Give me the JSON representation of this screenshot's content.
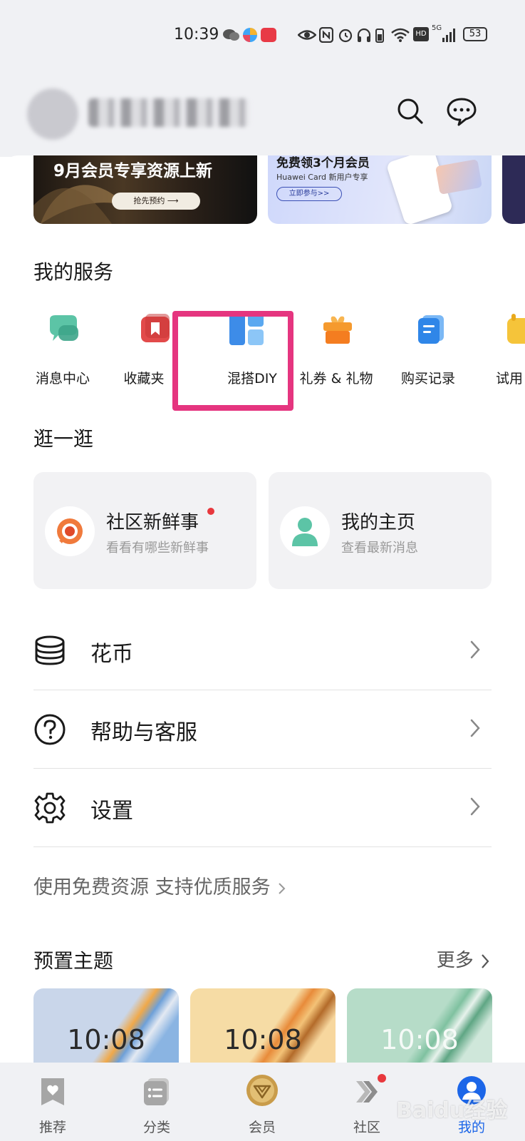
{
  "status_bar": {
    "time": "10:39",
    "network": "5G",
    "hd": "HD",
    "battery": "53"
  },
  "banners": [
    {
      "title": "9月会员专享资源上新",
      "button": "抢先预约 ⟶"
    },
    {
      "title": "免费领3个月会员",
      "subtitle": "Huawei Card 新用户专享",
      "button": "立即参与>>"
    }
  ],
  "services": {
    "title": "我的服务",
    "items": [
      {
        "label": "消息中心",
        "icon": "chat-bubbles-icon"
      },
      {
        "label": "收藏夹",
        "icon": "bookmark-icon"
      },
      {
        "label": "混搭DIY",
        "icon": "mix-diy-icon"
      },
      {
        "label": "礼券 & 礼物",
        "icon": "gift-icon"
      },
      {
        "label": "购买记录",
        "icon": "purchase-record-icon"
      },
      {
        "label": "试用",
        "icon": "trial-icon"
      }
    ]
  },
  "browse": {
    "title": "逛一逛",
    "cards": [
      {
        "title": "社区新鲜事",
        "subtitle": "看看有哪些新鲜事"
      },
      {
        "title": "我的主页",
        "subtitle": "查看最新消息"
      }
    ]
  },
  "menu": [
    {
      "label": "花币",
      "icon": "coins-icon"
    },
    {
      "label": "帮助与客服",
      "icon": "help-icon"
    },
    {
      "label": "设置",
      "icon": "gear-icon"
    }
  ],
  "promo": "使用免费资源 支持优质服务",
  "themes": {
    "title": "预置主题",
    "more": "更多",
    "items": [
      {
        "clock": "10:08"
      },
      {
        "clock": "10:08"
      },
      {
        "clock": "10:08"
      }
    ]
  },
  "tabs": [
    {
      "label": "推荐"
    },
    {
      "label": "分类"
    },
    {
      "label": "会员"
    },
    {
      "label": "社区"
    },
    {
      "label": "我的"
    }
  ],
  "watermark": "Baidu经验",
  "colors": {
    "accent": "#1c66e8",
    "highlight": "#e5357f",
    "badge": "#e8383d"
  }
}
